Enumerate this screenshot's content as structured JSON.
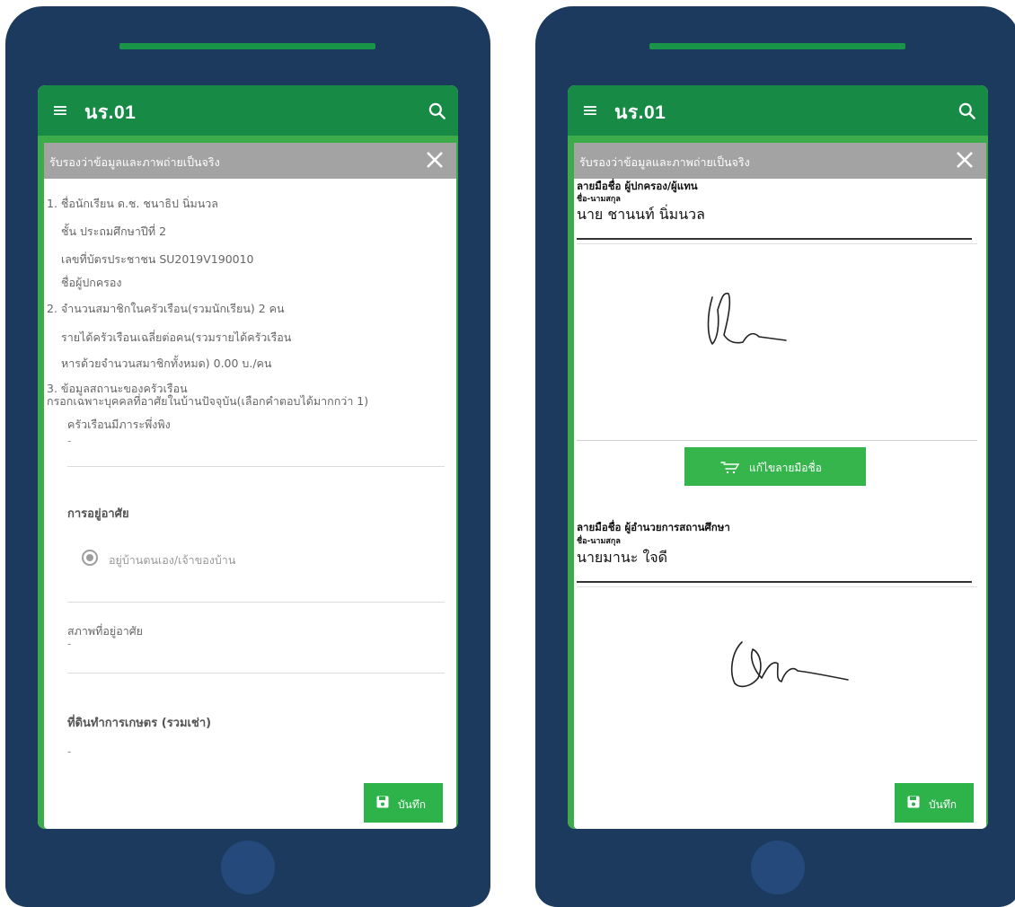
{
  "app": {
    "title": "นร.01"
  },
  "dialog": {
    "title": "รับรองว่าข้อมูลและภาพถ่ายเป็นจริง"
  },
  "left": {
    "student_name": "1. ชื่อนักเรียน  ด.ช. ชนาธิป นิ่มนวล",
    "grade": "ชั้น  ประถมศึกษาปีที่ 2",
    "id_card": "เลขที่บัตรประชาชน  SU2019V190010",
    "guardian": "ชื่อผู้ปกครอง",
    "household_members": "2. จำนวนสมาชิกในครัวเรือน(รวมนักเรียน)  2 คน",
    "income_line1": "รายได้ครัวเรือนเฉลี่ยต่อคน(รวมรายได้ครัวเรือน",
    "income_line2": "หารด้วยจำนวนสมาชิกทั้งหมด)  0.00 บ./คน",
    "status_line1": "3. ข้อมูลสถานะของครัวเรือน",
    "status_line2": "กรอกเฉพาะบุคคลที่อาศัยในบ้านปัจจุบัน(เลือกคำตอบได้มากกว่า 1)",
    "dependents_label": "ครัวเรือนมีภาระพึ่งพิง",
    "dependents_value": "-",
    "housing_heading": "การอยู่อาศัย",
    "housing_option": "อยู่บ้านตนเอง/เจ้าของบ้าน",
    "residence_label": "สภาพที่อยู่อาศัย",
    "residence_value": "-",
    "farmland_heading": "ที่ดินทำการเกษตร (รวมเช่า)",
    "farmland_value": "-",
    "save_label": "บันทึก"
  },
  "right": {
    "guardian_sig_label": "ลายมือชื่อ ผู้ปกครอง/ผู้แทน",
    "guardian_name_caption": "ชื่อ-นามสกุล",
    "guardian_name": "นาย ชานนท์ นิ่มนวล",
    "edit_sig_label": "แก้ไขลายมือชื่อ",
    "director_sig_label": "ลายมือชื่อ ผู้อำนวยการสถานศึกษา",
    "director_name_caption": "ชื่อ-นามสกุล",
    "director_name": "นายมานะ ใจดี",
    "save_label": "บันทึก"
  },
  "colors": {
    "phone_body": "#1c3a5e",
    "appbar": "#178a45",
    "button": "#2db34a",
    "dialog_header": "#a3a3a3"
  },
  "icons": [
    "menu-icon",
    "search-icon",
    "close-icon",
    "save-icon",
    "cart-icon",
    "radio-icon"
  ]
}
